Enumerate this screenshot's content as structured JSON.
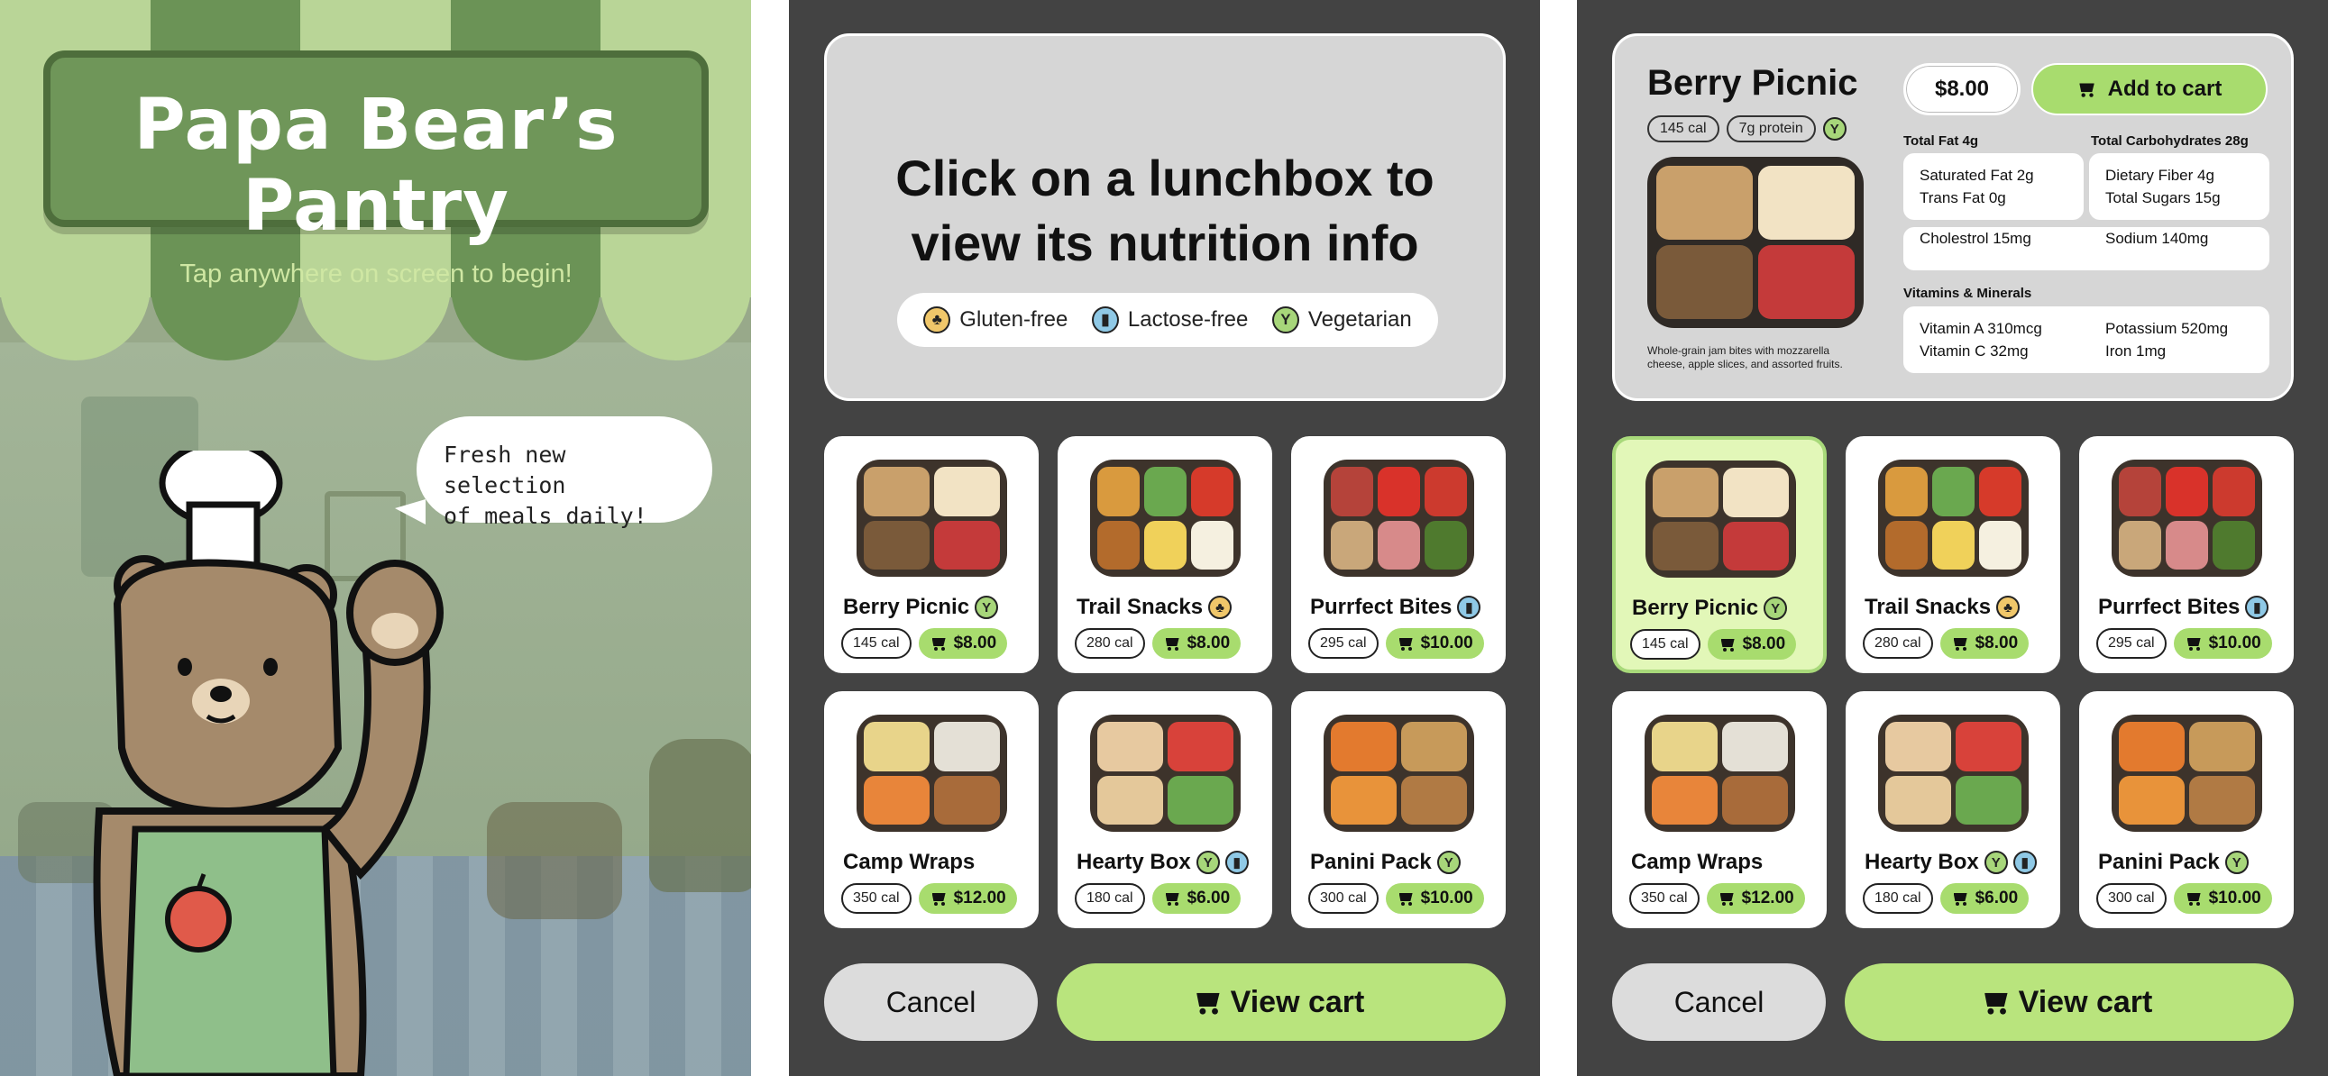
{
  "welcome": {
    "title": "Papa Bear’s Pantry",
    "subtitle": "Tap anywhere on screen to begin!",
    "speech_line1": "Fresh new selection",
    "speech_line2": "of meals daily!"
  },
  "prompt": {
    "line1": "Click on a lunchbox to",
    "line2": "view its nutrition info"
  },
  "legend": [
    {
      "icon": "wheat-icon",
      "label": "Gluten-free"
    },
    {
      "icon": "milk-icon",
      "label": "Lactose-free"
    },
    {
      "icon": "leaf-icon",
      "label": "Vegetarian"
    }
  ],
  "lunchboxes": [
    {
      "name": "Berry Picnic",
      "cal": "145 cal",
      "price": "$8.00",
      "badges": [
        "vegetarian"
      ]
    },
    {
      "name": "Trail Snacks",
      "cal": "280 cal",
      "price": "$8.00",
      "badges": [
        "gluten-free"
      ]
    },
    {
      "name": "Purrfect Bites",
      "cal": "295 cal",
      "price": "$10.00",
      "badges": [
        "lactose-free"
      ]
    },
    {
      "name": "Camp Wraps",
      "cal": "350 cal",
      "price": "$12.00",
      "badges": []
    },
    {
      "name": "Hearty Box",
      "cal": "180 cal",
      "price": "$6.00",
      "badges": [
        "vegetarian",
        "lactose-free"
      ]
    },
    {
      "name": "Panini Pack",
      "cal": "300 cal",
      "price": "$10.00",
      "badges": [
        "vegetarian"
      ]
    }
  ],
  "buttons": {
    "cancel": "Cancel",
    "view_cart": "View cart",
    "add_to_cart": "Add to cart"
  },
  "detail": {
    "name": "Berry Picnic",
    "calories": "145 cal",
    "protein": "7g protein",
    "price": "$8.00",
    "caption": "Whole-grain jam bites with mozzarella cheese, apple slices, and assorted fruits.",
    "total_fat": "Total Fat  4g",
    "total_carbs": "Total Carbohydrates  28g",
    "saturated_fat": "Saturated Fat  2g",
    "trans_fat": "Trans Fat  0g",
    "dietary_fiber": "Dietary Fiber  4g",
    "total_sugars": "Total Sugars  15g",
    "cholesterol": "Cholestrol  15mg",
    "sodium": "Sodium  140mg",
    "vitamins_heading": "Vitamins & Minerals",
    "vitamin_a": "Vitamin A  310mcg",
    "vitamin_c": "Vitamin C  32mg",
    "potassium": "Potassium  520mg",
    "iron": "Iron  1mg"
  },
  "selected_lunchbox": "Berry Picnic",
  "colors": {
    "background": "#434343",
    "accent_green": "#a8dc6e",
    "selected_card": "#e2f7b8",
    "sign_green": "#6f9659"
  }
}
